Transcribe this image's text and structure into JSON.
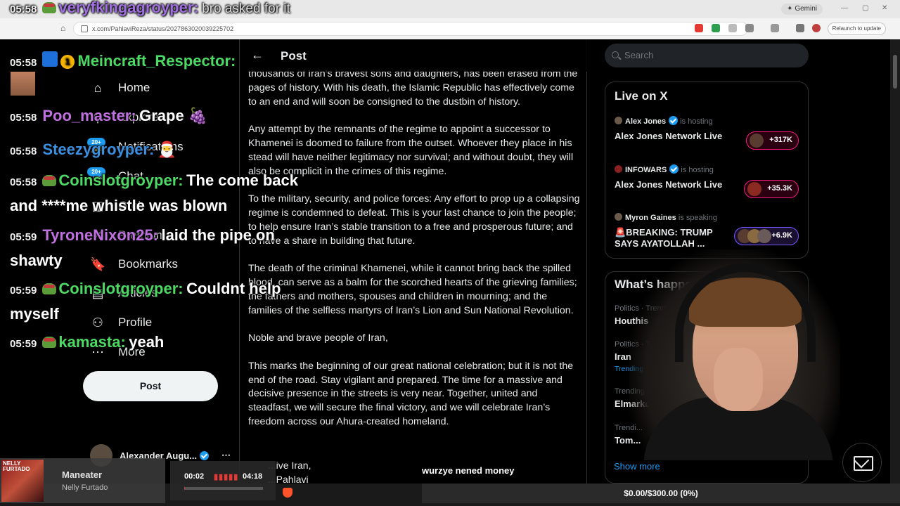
{
  "browser": {
    "gemini_label": "Gemini",
    "url": "x.com/PahlaviReza/status/2027863020039225702",
    "relaunch_label": "Relaunch to update"
  },
  "nav": {
    "items": [
      {
        "label": "Home",
        "icon": "home-icon"
      },
      {
        "label": "Explore",
        "icon": "search-icon"
      },
      {
        "label": "Notifications",
        "icon": "bell-icon"
      },
      {
        "label": "Chat",
        "icon": "chat-icon"
      },
      {
        "label": "Grok",
        "icon": "grok-icon"
      },
      {
        "label": "Premium",
        "icon": "x-icon"
      },
      {
        "label": "Bookmarks",
        "icon": "bookmark-icon"
      },
      {
        "label": "Articles",
        "icon": "article-icon"
      },
      {
        "label": "Profile",
        "icon": "person-icon"
      },
      {
        "label": "More",
        "icon": "more-icon"
      }
    ],
    "badge_notifications": "20+",
    "badge_chat": "20+",
    "post_button": "Post",
    "account_name": "Alexander Augu..."
  },
  "main": {
    "header_title": "Post",
    "paragraphs": [
      "thousands of Iran’s bravest sons and daughters, has been erased from the pages of history. With his death, the Islamic Republic has effectively come to an end and will soon be consigned to the dustbin of history.",
      "Any attempt by the remnants of the regime to appoint a successor to Khamenei is doomed to failure from the outset. Whoever they place in his stead will have neither legitimacy nor survival; and without doubt, they will also be complicit in the crimes of this regime.",
      "To the military, security, and police forces: Any effort to prop up a collapsing regime is condemned to defeat. This is your last chance to join the people; to help ensure Iran’s stable transition to a free and prosperous future; and to have a share in building that future.",
      "The death of the criminal Khamenei, while it cannot bring back the spilled blood, can serve as a balm for the scorched hearts of the grieving families; the fathers and mothers, spouses and children in mourning; and the families of the selfless martyrs of Iran’s Lion and Sun National Revolution.",
      "Noble and brave people of Iran,",
      "This marks the beginning of our great national celebration; but it is not the end of the road. Stay vigilant and prepared. The time for a massive and decisive presence in the streets is very near. Together, united and steadfast, we will secure the final victory, and we will celebrate Iran’s freedom across our Ahura-created homeland."
    ],
    "sign_line1": "...ive Iran,",
    "sign_line2": "...Pahlavi"
  },
  "right": {
    "search_placeholder": "Search",
    "live_title": "Live on X",
    "live": [
      {
        "host": "Alex Jones",
        "status": "is hosting",
        "title": "Alex Jones Network Live",
        "count": "+317K",
        "style": "pink"
      },
      {
        "host": "INFOWARS",
        "status": "is hosting",
        "title": "Alex Jones Network Live",
        "count": "+35.3K",
        "style": "pink"
      },
      {
        "host": "Myron Gaines",
        "status": "is speaking",
        "title": "🚨BREAKING: TRUMP SAYS AYATOLLAH ...",
        "count": "+6.9K",
        "style": "purple"
      }
    ],
    "happening_title": "What’s happe...",
    "trends": [
      {
        "category": "Politics · Trending",
        "name": "Houthis",
        "with": ""
      },
      {
        "category": "Politics · Trending",
        "name": "Iran",
        "with": "Trending with Kha..."
      },
      {
        "category": "Trending in Unit...",
        "name": "Elmarko",
        "with": ""
      },
      {
        "category": "Trendi...",
        "name": "Tom...",
        "with": ""
      }
    ],
    "show_more": "Show more"
  },
  "chat": {
    "messages": [
      {
        "time": "05:58",
        "user": "veryfkingagroyper:",
        "user_color": "#a070e0",
        "text": "bro asked for it"
      },
      {
        "time": "05:58",
        "user": "Meincraft_Respector:",
        "user_color": "#4cd964",
        "text": ""
      },
      {
        "time": "05:58",
        "user": "Poo_master:",
        "user_color": "#c070e0",
        "text": "Grape 🍇"
      },
      {
        "time": "05:58",
        "user": "Steezygroyper:",
        "user_color": "#3d8fe0",
        "text": "🎅"
      },
      {
        "time": "05:58",
        "user": "Coinslotgroyper:",
        "user_color": "#4cd964",
        "text": "The come back and ****me whistle was blown"
      },
      {
        "time": "05:59",
        "user": "TyroneNixon25:",
        "user_color": "#c070e0",
        "text": "laid the pipe on shawty"
      },
      {
        "time": "05:59",
        "user": "Coinslotgroyper:",
        "user_color": "#4cd964",
        "text": "Couldnt help myself"
      },
      {
        "time": "05:59",
        "user": "kamasta:",
        "user_color": "#4cd964",
        "text": "yeah"
      }
    ],
    "badge_number": "1"
  },
  "overlay": {
    "subtitle": "wurzye nened money",
    "goal_text": "$0.00/$300.00 (0%)",
    "goal_progress": 0,
    "song": "Maneater",
    "artist": "Nelly Furtado",
    "album_text": "NELLY FURTADO",
    "time_current": "00:02",
    "time_total": "04:18",
    "song_progress": 0.008
  }
}
